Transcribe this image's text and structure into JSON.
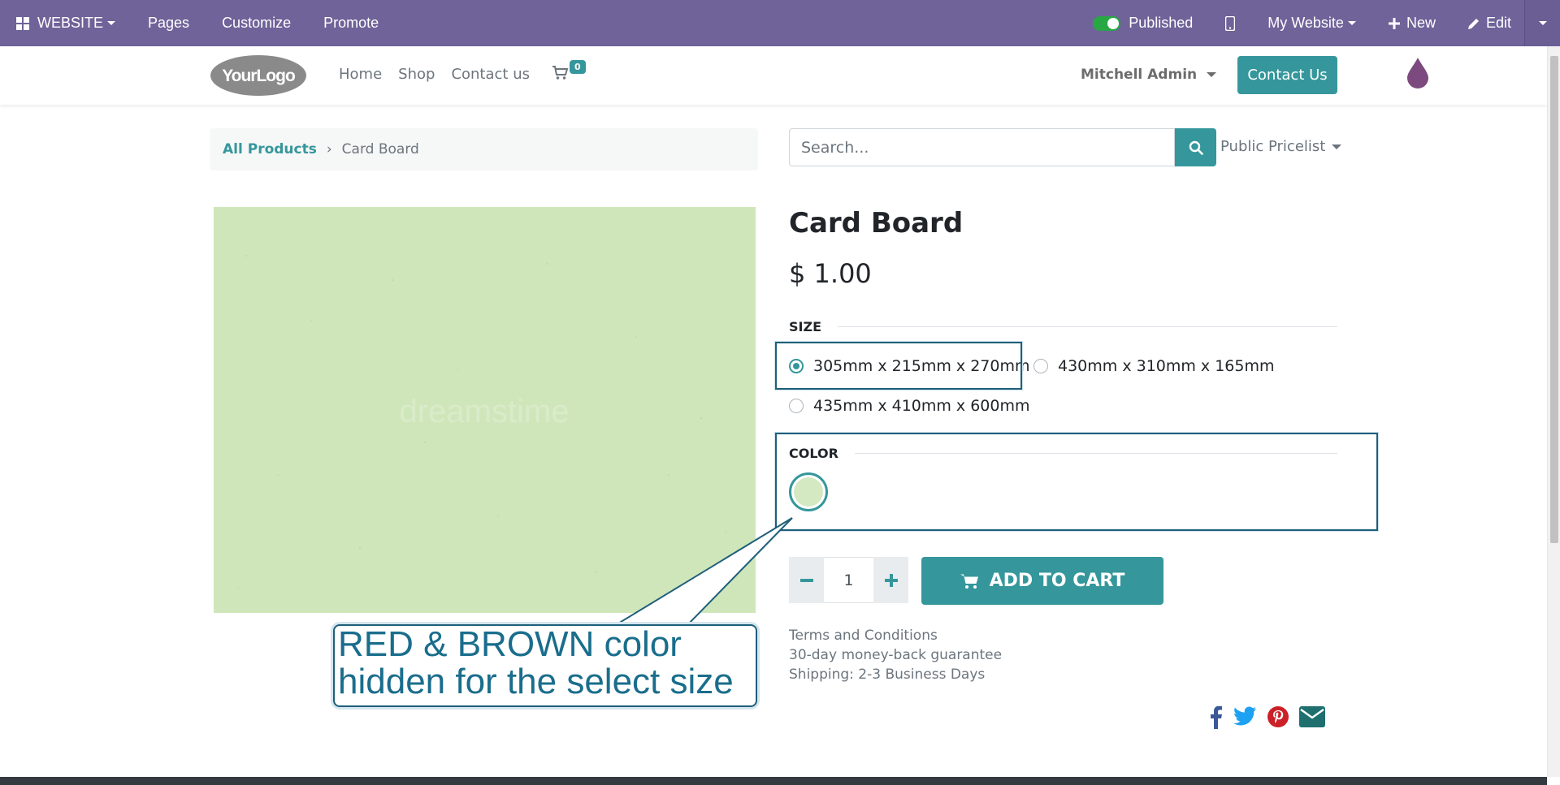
{
  "adminbar": {
    "website_label": "WEBSITE",
    "pages_label": "Pages",
    "customize_label": "Customize",
    "promote_label": "Promote",
    "published_label": "Published",
    "mywebsite_label": "My Website",
    "new_label": "New",
    "edit_label": "Edit"
  },
  "header": {
    "logo_text": "YourLogo",
    "nav": [
      "Home",
      "Shop",
      "Contact us"
    ],
    "cart_count": "0",
    "user_name": "Mitchell Admin",
    "contact_button": "Contact Us"
  },
  "breadcrumb": {
    "parent": "All Products",
    "current": "Card Board"
  },
  "search": {
    "placeholder": "Search...",
    "pricelist": "Public Pricelist"
  },
  "product": {
    "name": "Card Board",
    "price": "$ 1.00",
    "image_color": "#cfe6ba",
    "image_watermark": "dreamstime",
    "size_label": "SIZE",
    "sizes": [
      {
        "label": "305mm x 215mm x 270mm",
        "checked": true
      },
      {
        "label": "430mm x 310mm x 165mm",
        "checked": false
      },
      {
        "label": "435mm x 410mm x 600mm",
        "checked": false
      }
    ],
    "color_label": "COLOR",
    "color_swatch": "#d4e9c2",
    "quantity": "1",
    "add_to_cart": "ADD TO CART",
    "terms": [
      "Terms and Conditions",
      "30-day money-back guarantee",
      "Shipping: 2-3 Business Days"
    ]
  },
  "callout": {
    "line1": "RED & BROWN color",
    "line2": "hidden for the select size"
  },
  "colors": {
    "admin_bar": "#6f6399",
    "accent": "#35979c",
    "callout_border": "#1f5f7a"
  }
}
